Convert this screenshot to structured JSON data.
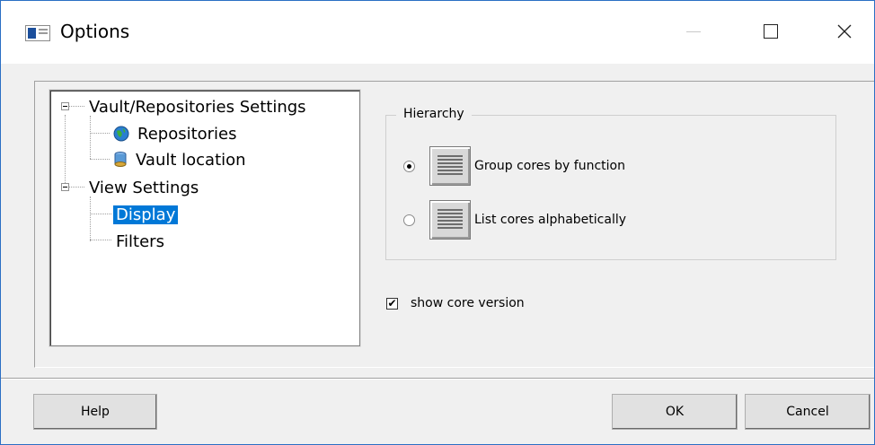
{
  "window": {
    "title": "Options",
    "accent_color": "#2b6fc4",
    "controls": {
      "minimize_icon": "minimize-icon",
      "maximize_icon": "maximize-icon",
      "close_icon": "close-icon"
    }
  },
  "tree": {
    "items": [
      {
        "label": "Vault/Repositories Settings",
        "icon": "minus-expander-icon",
        "expanded": true
      },
      {
        "label": "Repositories",
        "icon": "globe-icon"
      },
      {
        "label": "Vault location",
        "icon": "database-icon"
      },
      {
        "label": "View Settings",
        "icon": "minus-expander-icon",
        "expanded": true
      },
      {
        "label": "Display",
        "selected": true
      },
      {
        "label": "Filters"
      }
    ],
    "selection_color": "#0078d7"
  },
  "hierarchy": {
    "legend": "Hierarchy",
    "options": [
      {
        "label": "Group cores by function",
        "checked": true,
        "icon": "list-icon"
      },
      {
        "label": "List cores alphabetically",
        "checked": false,
        "icon": "list-icon"
      }
    ]
  },
  "show_core_version": {
    "label": "show core version",
    "checked": true
  },
  "buttons": {
    "help": "Help",
    "ok": "OK",
    "cancel": "Cancel"
  }
}
